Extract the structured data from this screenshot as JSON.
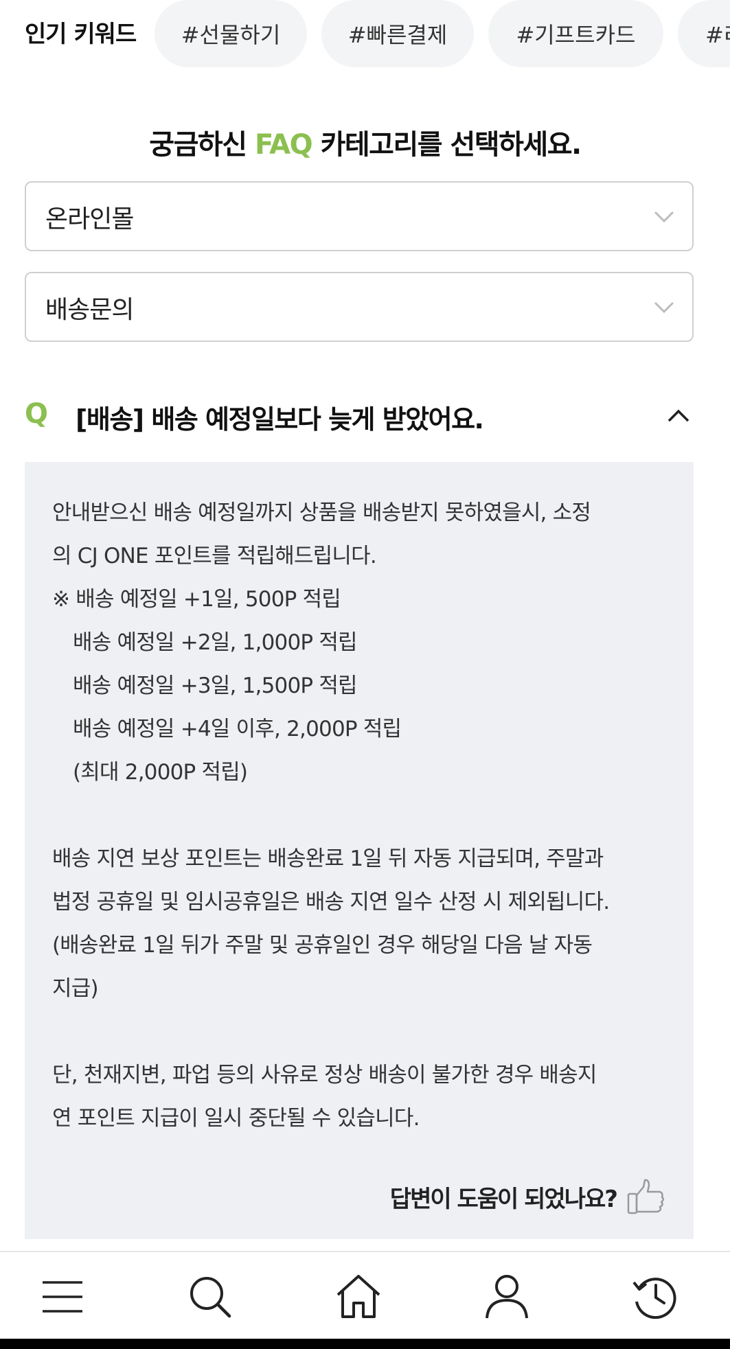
{
  "keywords": {
    "title": "인기 키워드",
    "chips": [
      "#선물하기",
      "#빠른결제",
      "#기프트카드",
      "#리"
    ]
  },
  "faq": {
    "heading_pre": "궁금하신 ",
    "heading_accent": "FAQ",
    "heading_post": " 카테고리를 선택하세요.",
    "select_category": "온라인몰",
    "select_subcategory": "배송문의"
  },
  "question": {
    "mark": "Q",
    "text": "[배송] 배송 예정일보다 늦게 받았어요."
  },
  "answer": {
    "lines": [
      "안내받으신 배송 예정일까지 상품을 배송받지 못하였을시, 소정",
      "의 CJ ONE 포인트를 적립해드립니다.",
      "※  배송 예정일 +1일, 500P 적립",
      "배송 예정일 +2일, 1,000P 적립",
      "배송 예정일 +3일, 1,500P 적립",
      "배송 예정일 +4일 이후, 2,000P 적립",
      "(최대 2,000P 적립)",
      "배송 지연 보상 포인트는 배송완료 1일 뒤 자동 지급되며, 주말과",
      "법정 공휴일 및 임시공휴일은 배송 지연 일수 산정 시 제외됩니다.",
      "(배송완료 1일 뒤가 주말 및 공휴일인 경우 해당일 다음 날 자동",
      "지급)",
      "단, 천재지변, 파업 등의 사유로 정상 배송이 불가한 경우 배송지",
      "연 포인트 지급이 일시 중단될 수 있습니다."
    ],
    "helpful_text": "답변이 도움이 되었나요?"
  },
  "colors": {
    "accent": "#8bbf4f",
    "panel_bg": "#eef0f4",
    "chip_bg": "#f3f4f6"
  },
  "icons": {
    "chevron": "chevron-down-icon",
    "collapse": "chevron-up-icon",
    "thumb": "thumbs-up-icon",
    "nav": [
      "menu-icon",
      "search-icon",
      "home-icon",
      "user-icon",
      "history-icon"
    ]
  }
}
